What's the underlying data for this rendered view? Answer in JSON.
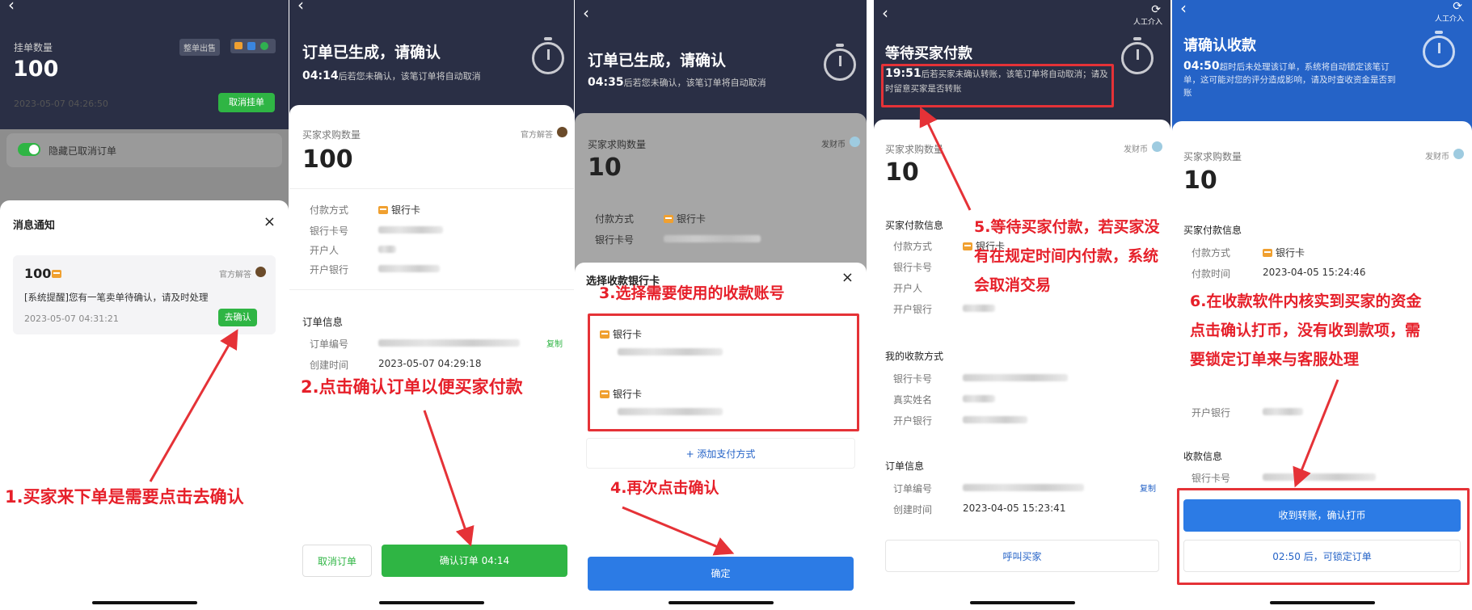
{
  "s1": {
    "title": "挂单数量",
    "qty": "100",
    "tag1": "整单出售",
    "time": "2023-05-07 04:26:50",
    "cancel_btn": "取消挂单",
    "toggle_label": "隐藏已取消订单",
    "modal_title": "消息通知",
    "close": "×",
    "msg_qty": "100",
    "msg_badge": "官方解答",
    "msg_text": "[系统提醒]您有一笔卖单待确认，请及时处理",
    "msg_time": "2023-05-07 04:31:21",
    "go_confirm": "去确认",
    "annot": "1.买家来下单是需要点击去确认"
  },
  "s2": {
    "header": "订单已生成，请确认",
    "countdown": "04:14",
    "sub": "后若您未确认，该笔订单将自动取消",
    "buy_qty_label": "买家求购数量",
    "badge": "官方解答",
    "qty": "100",
    "pay_method": "付款方式",
    "bank": "银行卡",
    "card_no": "银行卡号",
    "holder": "开户人",
    "open_bank": "开户银行",
    "order_info": "订单信息",
    "order_no": "订单编号",
    "copy": "复制",
    "created": "创建时间",
    "created_val": "2023-05-07 04:29:18",
    "cancel": "取消订单",
    "confirm": "确认订单 04:14",
    "annot": "2.点击确认订单以便买家付款"
  },
  "s3": {
    "header": "订单已生成，请确认",
    "countdown": "04:35",
    "sub": "后若您未确认，该笔订单将自动取消",
    "buy_qty_label": "买家求购数量",
    "badge": "发财币",
    "qty": "10",
    "pay_method": "付款方式",
    "bank": "银行卡",
    "card_no": "银行卡号",
    "sheet_title": "选择收款银行卡",
    "close": "×",
    "opt1": "银行卡",
    "opt2": "银行卡",
    "add": "+ 添加支付方式",
    "ok": "确定",
    "annot3": "3.选择需要使用的收款账号",
    "annot4": "4.再次点击确认"
  },
  "s4": {
    "service": "人工介入",
    "header": "等待买家付款",
    "countdown": "19:51",
    "sub": "后若买家未确认转账，该笔订单将自动取消；请及时留意买家是否转账",
    "buy_qty_label": "买家求购数量",
    "badge": "发财币",
    "qty": "10",
    "pay_info": "买家付款信息",
    "pay_method": "付款方式",
    "bank": "银行卡",
    "card_no": "银行卡号",
    "holder": "开户人",
    "open_bank": "开户银行",
    "my_method": "我的收款方式",
    "real_name": "真实姓名",
    "order_info": "订单信息",
    "order_no": "订单编号",
    "copy": "复制",
    "created": "创建时间",
    "created_val": "2023-04-05 15:23:41",
    "call": "呼叫买家",
    "annot": "5.等待买家付款，若买家没有在规定时间内付款，系统会取消交易"
  },
  "s5": {
    "service": "人工介入",
    "header": "请确认收款",
    "countdown": "04:50",
    "sub": "超时后未处理该订单，系统将自动锁定该笔订单，这可能对您的评分造成影响，请及时查收资金是否到账",
    "buy_qty_label": "买家求购数量",
    "badge": "发财币",
    "qty": "10",
    "pay_info": "买家付款信息",
    "pay_method": "付款方式",
    "bank": "银行卡",
    "pay_time": "付款时间",
    "pay_time_val": "2023-04-05 15:24:46",
    "open_bank": "开户银行",
    "recv_info": "收款信息",
    "card_no": "银行卡号",
    "confirm": "收到转账，确认打币",
    "lock": "02:50 后，可锁定订单",
    "annot": "6.在收款软件内核实到买家的资金点击确认打币，没有收到款项，需要锁定订单来与客服处理"
  },
  "colors": {
    "navy": "#2a2f45",
    "blue": "#2563c7",
    "green": "#2fb544",
    "red": "#e6202a"
  }
}
